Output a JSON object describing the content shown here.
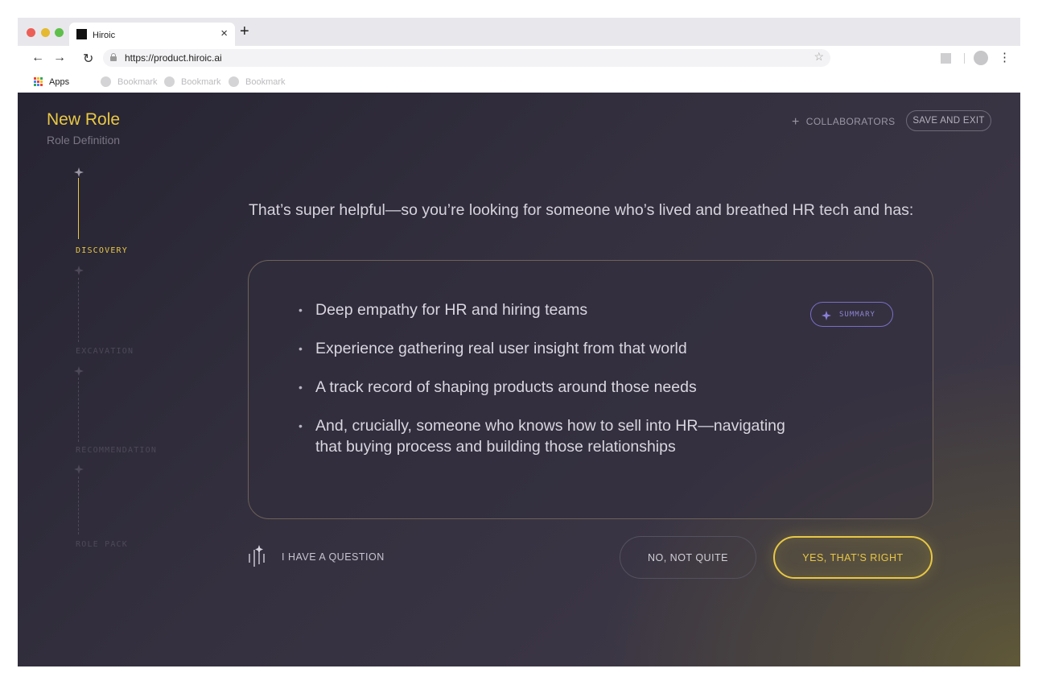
{
  "browser": {
    "tab_title": "Hiroic",
    "tab_close": "×",
    "new_tab": "+",
    "back": "←",
    "forward": "→",
    "reload": "↻",
    "url": "https://product.hiroic.ai",
    "star": "☆",
    "menu": "⋮",
    "bookmarks": {
      "apps_label": "Apps",
      "items": [
        "Bookmark",
        "Bookmark",
        "Bookmark"
      ]
    }
  },
  "header": {
    "title": "New Role",
    "subtitle": "Role Definition",
    "collaborators_label": "COLLABORATORS",
    "plus": "+",
    "save_exit_label": "SAVE AND EXIT"
  },
  "stepper": {
    "steps": [
      {
        "label": "DISCOVERY",
        "active": true
      },
      {
        "label": "EXCAVATION",
        "active": false
      },
      {
        "label": "RECOMMENDATION",
        "active": false
      },
      {
        "label": "ROLE PACK",
        "active": false
      }
    ]
  },
  "main": {
    "prompt": "That’s super helpful—so you’re looking for someone who’s lived and breathed HR tech and has:",
    "bullets": [
      "Deep empathy for HR and hiring teams",
      "Experience gathering real user insight from that world",
      "A track record of shaping products around those needs",
      "And, crucially, someone who knows how to sell into HR—navigating that buying process and building those relationships"
    ],
    "summary_label": "SUMMARY",
    "question_label": "I HAVE A QUESTION",
    "no_label": "NO, NOT QUITE",
    "yes_label": "YES, THAT’S RIGHT"
  },
  "colors": {
    "accent": "#e8c844",
    "summary": "#8f85d4",
    "background": "#2e2a38",
    "apps_icon": [
      "#ea4335",
      "#fbbc05",
      "#34a853",
      "#4285f4",
      "#ea4335",
      "#fbbc05",
      "#34a853",
      "#4285f4",
      "#ea4335"
    ]
  }
}
